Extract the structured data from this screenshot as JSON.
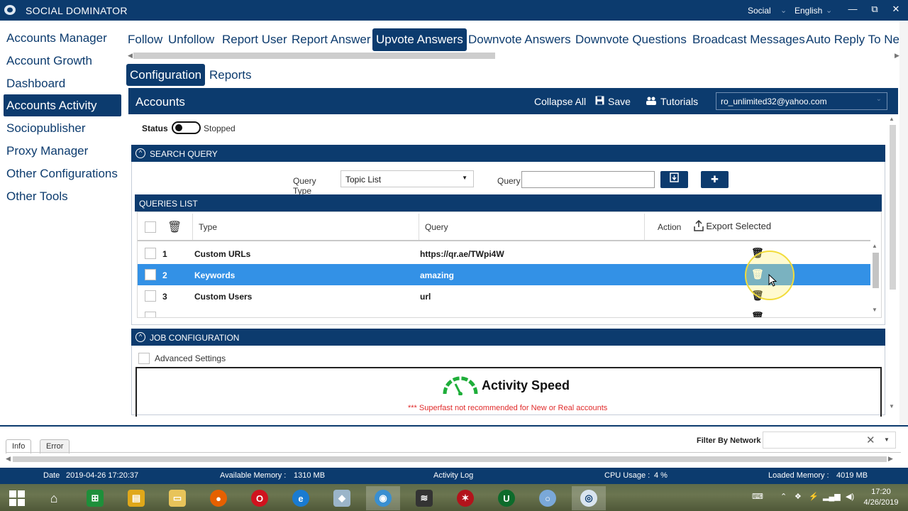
{
  "app": {
    "title": "SOCIAL DOMINATOR",
    "network": "Social",
    "language": "English",
    "win_minimize": "—",
    "win_restore": "⧉",
    "win_close": "✕"
  },
  "sidebar": {
    "items": [
      {
        "label": "Accounts Manager"
      },
      {
        "label": "Account Growth"
      },
      {
        "label": "Dashboard"
      },
      {
        "label": "Accounts Activity",
        "active": true
      },
      {
        "label": "Sociopublisher"
      },
      {
        "label": "Proxy Manager"
      },
      {
        "label": "Other Configurations"
      },
      {
        "label": "Other Tools"
      }
    ]
  },
  "main_tabs": [
    {
      "label": "Follow"
    },
    {
      "label": "Unfollow"
    },
    {
      "label": "Report User"
    },
    {
      "label": "Report Answer"
    },
    {
      "label": "Upvote Answers",
      "active": true
    },
    {
      "label": "Downvote Answers"
    },
    {
      "label": "Downvote Questions"
    },
    {
      "label": "Broadcast Messages"
    },
    {
      "label": "Auto Reply To New"
    }
  ],
  "sub_tabs": [
    {
      "label": "Configuration",
      "active": true
    },
    {
      "label": "Reports"
    }
  ],
  "accounts_bar": {
    "title": "Accounts",
    "collapse_all": "Collapse All",
    "save": "Save",
    "tutorials": "Tutorials",
    "selected_account": "ro_unlimited32@yahoo.com"
  },
  "status": {
    "label": "Status",
    "state": "Stopped"
  },
  "search_query": {
    "heading": "SEARCH QUERY",
    "query_type_label": "Query Type",
    "query_type_value": "Topic List",
    "query_label": "Query",
    "query_value": ""
  },
  "queries_list": {
    "heading": "QUERIES LIST",
    "columns": {
      "type": "Type",
      "query": "Query",
      "action": "Action",
      "export": "Export Selected"
    },
    "rows": [
      {
        "num": "1",
        "type": "Custom URLs",
        "query": "https://qr.ae/TWpi4W"
      },
      {
        "num": "2",
        "type": "Keywords",
        "query": "amazing",
        "selected": true
      },
      {
        "num": "3",
        "type": "Custom Users",
        "query": "url"
      }
    ]
  },
  "job_config": {
    "heading": "JOB CONFIGURATION",
    "advanced_settings": "Advanced Settings",
    "activity_speed": "Activity Speed",
    "warning": "*** Superfast not recommended for New or Real accounts"
  },
  "log": {
    "tabs": [
      {
        "label": "Info",
        "active": true
      },
      {
        "label": "Error"
      }
    ],
    "filter_label": "Filter By Network",
    "filter_value": ""
  },
  "statusbar": {
    "date_label": "Date",
    "date_value": "2019-04-26 17:20:37",
    "memory_label": "Available Memory :",
    "memory_value": "1310 MB",
    "activity_log": "Activity Log",
    "cpu_label": "CPU Usage :",
    "cpu_value": "4 %",
    "loaded_label": "Loaded Memory :",
    "loaded_value": "4019 MB"
  },
  "taskbar": {
    "time": "17:20",
    "date": "4/26/2019"
  },
  "colors": {
    "brand": "#0c3b6e",
    "selected_row": "#3391e6",
    "warning": "#e02b2b",
    "gauge": "#1fae3a"
  }
}
